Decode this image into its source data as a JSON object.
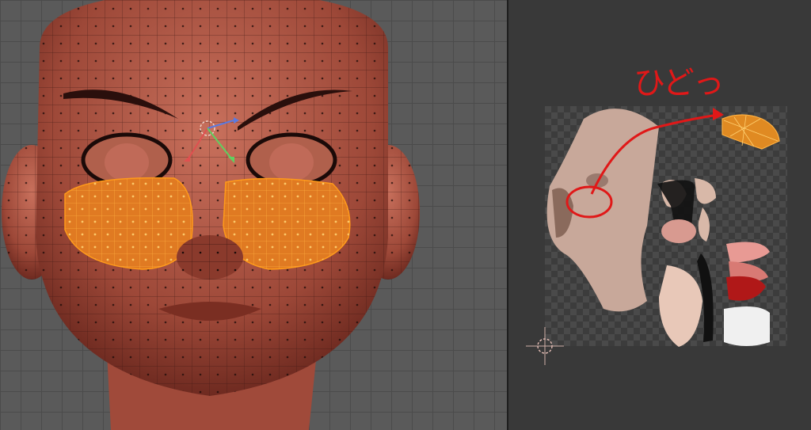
{
  "uv_editor": {
    "annotation": "ひどっ"
  },
  "colors": {
    "selection": "#ff9a1a",
    "skin_red": "#b85a48",
    "annotation_red": "#e01818",
    "viewport_bg": "#5a5a5a",
    "uv_bg": "#393939"
  },
  "icons": [
    "transform-gizmo-icon",
    "cursor-crosshair-icon"
  ]
}
